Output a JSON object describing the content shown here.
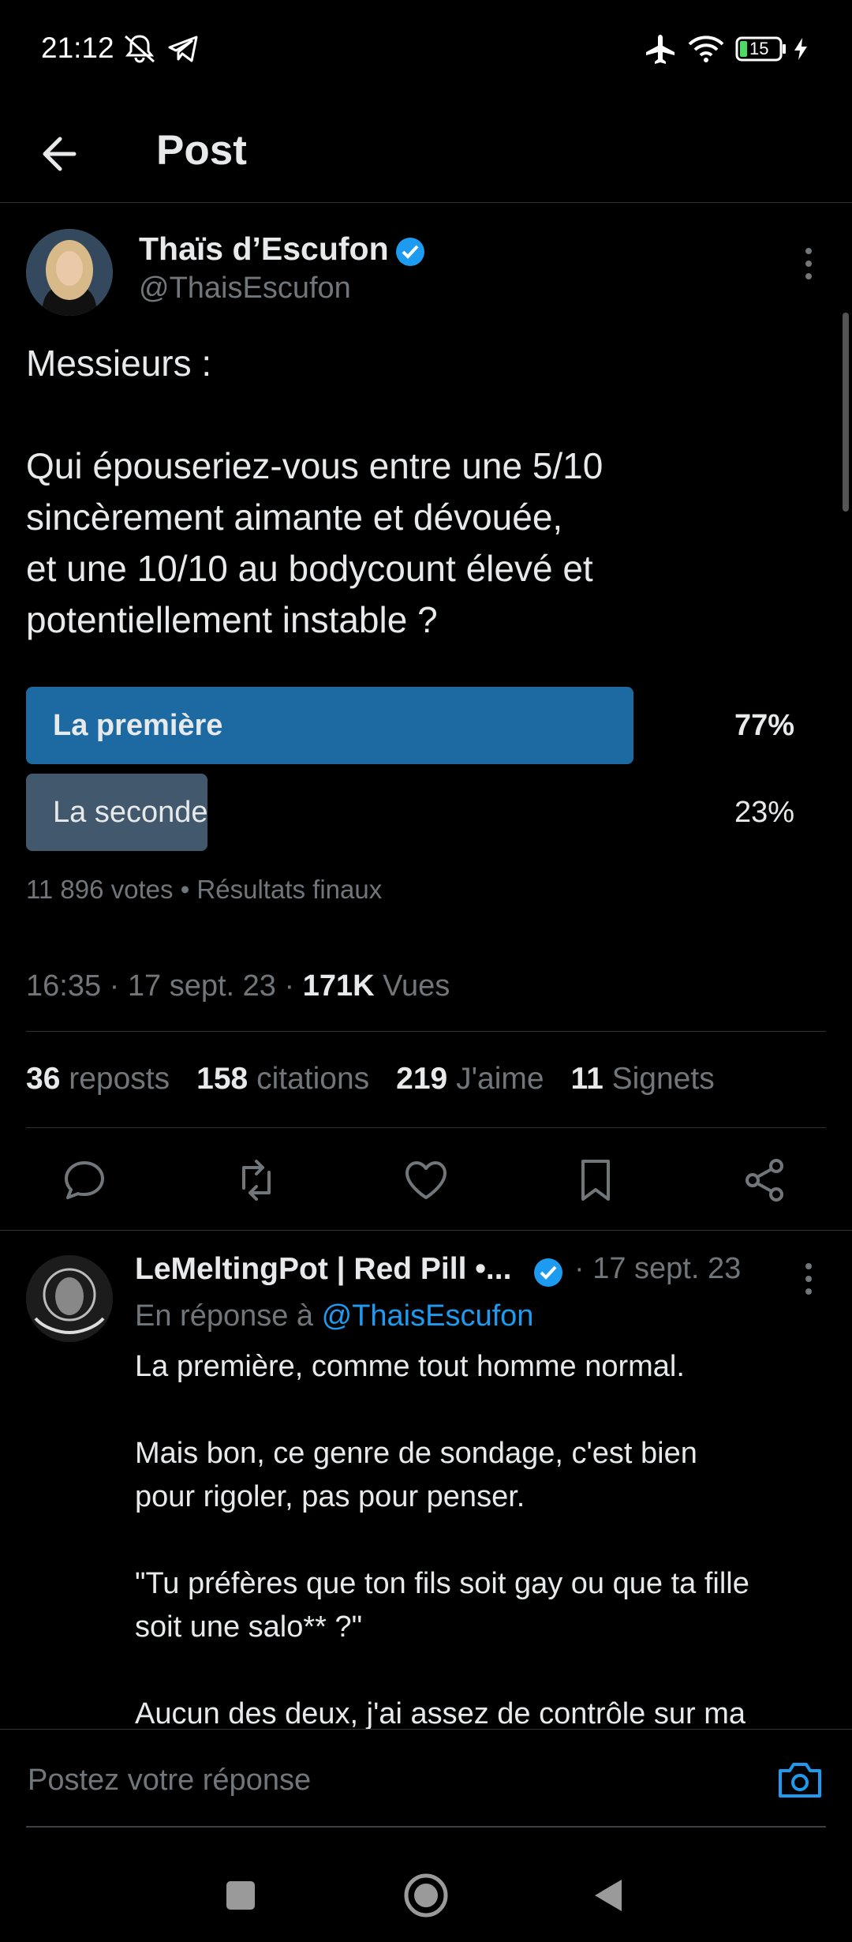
{
  "status_bar": {
    "time": "21:12",
    "battery": "15"
  },
  "header": {
    "title": "Post"
  },
  "tweet": {
    "author_name": "Thaïs d’Escufon",
    "author_handle": "@ThaisEscufon",
    "text": "Messieurs :\n\nQui épouseriez-vous entre une 5/10\nsincèrement aimante et dévouée,\net une 10/10 au bodycount élevé et\npotentiellement instable ?",
    "poll": {
      "options": [
        {
          "label": "La première",
          "percent": "77%",
          "value": 77
        },
        {
          "label": "La seconde",
          "percent": "23%",
          "value": 23
        }
      ],
      "meta": "11 896 votes • Résultats finaux"
    },
    "time": "16:35",
    "date": "17 sept. 23",
    "views_count": "171K",
    "views_label": "Vues",
    "stats": {
      "reposts_count": "36",
      "reposts_label": "reposts",
      "quotes_count": "158",
      "quotes_label": "citations",
      "likes_count": "219",
      "likes_label": "J'aime",
      "bookmarks_count": "11",
      "bookmarks_label": "Signets"
    }
  },
  "reply": {
    "author_name": "LeMeltingPot | Red Pill •...",
    "date": "· 17 sept. 23",
    "context_prefix": "En réponse à",
    "context_handle": "@ThaisEscufon",
    "text": "La première, comme tout homme normal.\n\nMais bon, ce genre de sondage, c'est bien\npour rigoler, pas pour penser.\n\n\"Tu préfères que ton fils soit gay ou que ta fille\nsoit une salo** ?\"\n\nAucun des deux, j'ai assez de contrôle sur ma"
  },
  "compose": {
    "placeholder": "Postez votre réponse"
  },
  "colors": {
    "poll_winner": "#1d6aa3",
    "poll_loser": "#42596d",
    "accent": "#1d9bf0"
  }
}
